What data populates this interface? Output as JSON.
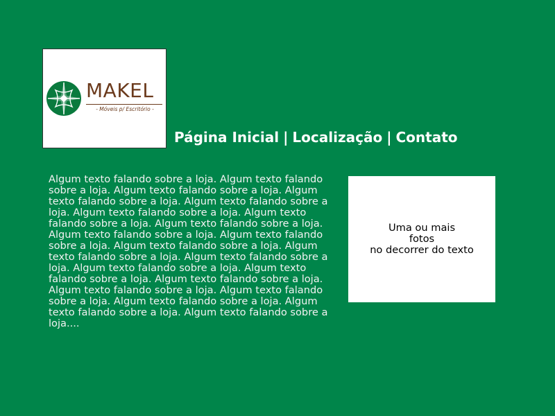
{
  "logo": {
    "name": "MAKEL",
    "tagline": "- Móveis p/ Escritório -",
    "brand_color": "#6b3a1c",
    "emblem_color": "#0a7a3e",
    "icon": "makel-emblem-icon"
  },
  "nav": {
    "items": [
      {
        "label": "Página Inicial"
      },
      {
        "label": "Localização"
      },
      {
        "label": "Contato"
      }
    ],
    "separator": "|"
  },
  "content": {
    "body": "Algum texto falando sobre a loja. Algum texto falando sobre a loja. Algum texto falando sobre a loja. Algum texto falando sobre a loja. Algum texto falando sobre a loja. Algum texto falando sobre a loja. Algum texto falando sobre a loja. Algum texto falando sobre a loja. Algum texto falando sobre a loja. Algum texto falando sobre a loja. Algum texto falando sobre a loja. Algum texto falando sobre a loja. Algum texto falando sobre a loja. Algum texto falando sobre a loja. Algum texto falando sobre a loja. Algum texto falando sobre a loja. Algum texto falando sobre a loja. Algum texto falando sobre a loja. Algum texto falando sobre a loja. Algum texto falando sobre a loja. Algum texto falando sobre a loja....",
    "photo_placeholder": {
      "line1": "Uma ou mais",
      "line2": "fotos",
      "line3": "no decorrer do texto"
    }
  },
  "colors": {
    "background": "#00854a",
    "text": "#f2f2f2"
  }
}
